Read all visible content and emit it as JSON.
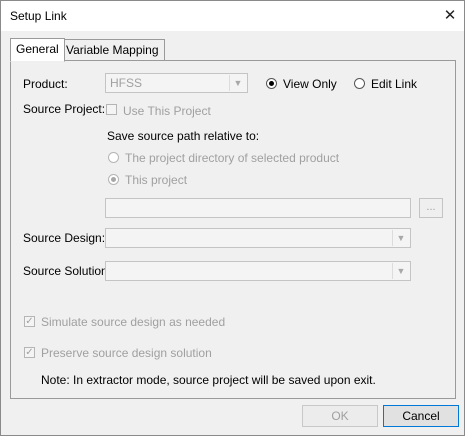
{
  "window": {
    "title": "Setup Link",
    "close_glyph": "✕"
  },
  "tabs": [
    {
      "label": "General",
      "active": true
    },
    {
      "label": "Variable Mapping",
      "active": false
    }
  ],
  "product": {
    "label": "Product:",
    "value": "HFSS",
    "view_only_label": "View Only",
    "edit_link_label": "Edit Link",
    "mode_selected": "View Only"
  },
  "source_project": {
    "label": "Source Project:",
    "use_this_project_label": "Use This Project",
    "use_this_project_checked": false,
    "save_path_label": "Save source path relative to:",
    "option_product_dir": "The project directory of selected product",
    "option_this_project": "This project",
    "selected_option": "This project",
    "path_value": "",
    "browse_label": "..."
  },
  "source_design": {
    "label": "Source Design:",
    "value": ""
  },
  "source_solution": {
    "label": "Source Solution:",
    "value": ""
  },
  "options": {
    "simulate_label": "Simulate source design as needed",
    "simulate_checked": true,
    "preserve_label": "Preserve source design solution",
    "preserve_checked": true
  },
  "note": "Note: In extractor mode, source project will be saved upon exit.",
  "buttons": {
    "ok": "OK",
    "cancel": "Cancel"
  },
  "check_glyph": "✓",
  "arrow_glyph": "▼"
}
